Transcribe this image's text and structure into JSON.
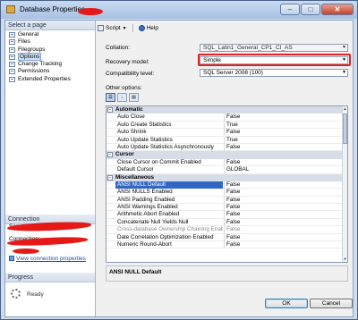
{
  "window": {
    "title": "Database Properties -",
    "buttons": {
      "minimize": "–",
      "maximize": "□",
      "close": "✕"
    }
  },
  "left": {
    "select_page_header": "Select a page",
    "pages": [
      {
        "label": "General",
        "selected": false
      },
      {
        "label": "Files",
        "selected": false
      },
      {
        "label": "Filegroups",
        "selected": false
      },
      {
        "label": "Options",
        "selected": true
      },
      {
        "label": "Change Tracking",
        "selected": false
      },
      {
        "label": "Permissions",
        "selected": false
      },
      {
        "label": "Extended Properties",
        "selected": false
      }
    ],
    "connection_header": "Connection",
    "server_label": "Server:",
    "connection_label": "Connection:",
    "view_connection_link": "View connection properties",
    "progress_header": "Progress",
    "progress_status": "Ready"
  },
  "toolbar": {
    "script_label": "Script",
    "help_label": "Help"
  },
  "fields": {
    "collation_label": "Collation:",
    "collation_value": "SQL_Latin1_General_CP1_CI_AS",
    "recovery_label": "Recovery model:",
    "recovery_value": "Simple",
    "compat_label": "Compatibility level:",
    "compat_value": "SQL Server 2008 (100)"
  },
  "other_options_label": "Other options:",
  "grid": {
    "sections": [
      {
        "name": "Automatic",
        "rows": [
          {
            "name": "Auto Close",
            "value": "False"
          },
          {
            "name": "Auto Create Statistics",
            "value": "True"
          },
          {
            "name": "Auto Shrink",
            "value": "False"
          },
          {
            "name": "Auto Update Statistics",
            "value": "True"
          },
          {
            "name": "Auto Update Statistics Asynchronously",
            "value": "False"
          }
        ]
      },
      {
        "name": "Cursor",
        "rows": [
          {
            "name": "Close Cursor on Commit Enabled",
            "value": "False"
          },
          {
            "name": "Default Cursor",
            "value": "GLOBAL"
          }
        ]
      },
      {
        "name": "Miscellaneous",
        "rows": [
          {
            "name": "ANSI NULL Default",
            "value": "False",
            "selected": true
          },
          {
            "name": "ANSI NULLS Enabled",
            "value": "False"
          },
          {
            "name": "ANSI Padding Enabled",
            "value": "False"
          },
          {
            "name": "ANSI Warnings Enabled",
            "value": "False"
          },
          {
            "name": "Arithmetic Abort Enabled",
            "value": "False"
          },
          {
            "name": "Concatenate Null Yields Null",
            "value": "False"
          },
          {
            "name": "Cross-database Ownership Chaining Enabled",
            "value": "False",
            "dim": true
          },
          {
            "name": "Date Correlation Optimization Enabled",
            "value": "False"
          },
          {
            "name": "Numeric Round-Abort",
            "value": "False"
          }
        ]
      }
    ]
  },
  "description_text": "ANSI NULL Default",
  "buttons": {
    "ok": "OK",
    "cancel": "Cancel"
  }
}
